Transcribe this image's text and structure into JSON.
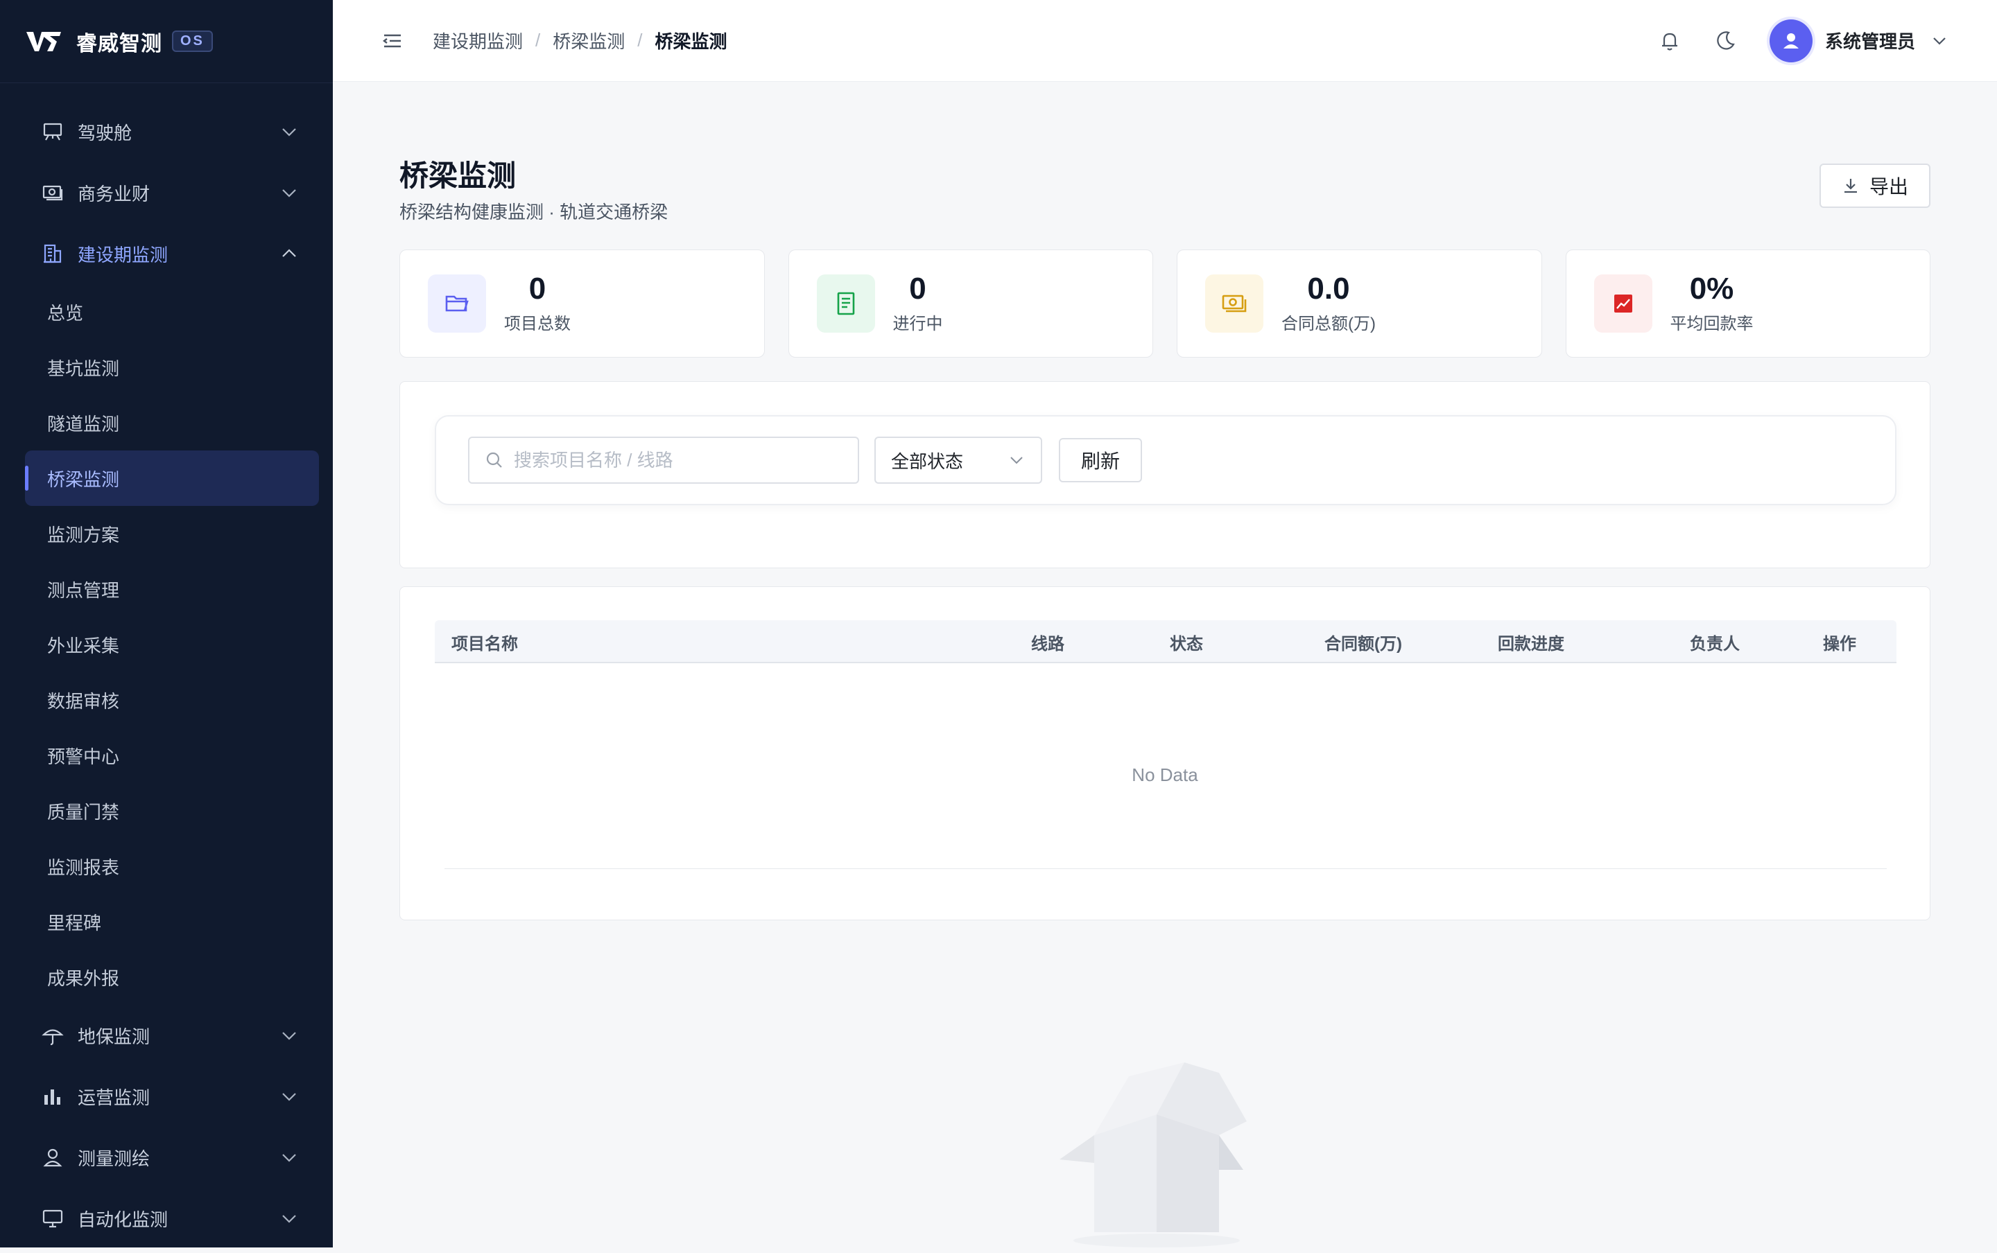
{
  "app": {
    "name": "睿威智测",
    "badge": "OS"
  },
  "sidebar": {
    "groups_top": [
      {
        "label": "驾驶舱",
        "icon": "presentation-board-icon"
      },
      {
        "label": "商务业财",
        "icon": "cash-icon"
      }
    ],
    "open_group": {
      "label": "建设期监测",
      "icon": "building-icon"
    },
    "subitems": [
      "总览",
      "基坑监测",
      "隧道监测",
      "桥梁监测",
      "监测方案",
      "测点管理",
      "外业采集",
      "数据审核",
      "预警中心",
      "质量门禁",
      "监测报表",
      "里程碑",
      "成果外报"
    ],
    "active_subitem": "桥梁监测",
    "groups_bottom": [
      {
        "label": "地保监测",
        "icon": "umbrella-icon"
      },
      {
        "label": "运营监测",
        "icon": "bar-chart-icon"
      },
      {
        "label": "测量测绘",
        "icon": "user-location-icon"
      },
      {
        "label": "自动化监测",
        "icon": "monitor-icon"
      }
    ]
  },
  "header": {
    "breadcrumb": [
      "建设期监测",
      "桥梁监测",
      "桥梁监测"
    ],
    "user_name": "系统管理员"
  },
  "page": {
    "title": "桥梁监测",
    "subtitle": "桥梁结构健康监测 · 轨道交通桥梁",
    "export_label": "导出"
  },
  "stats": [
    {
      "value": "0",
      "label": "项目总数",
      "icon": "folder-icon",
      "color": "#5b5ff0",
      "bg": "#eef0ff"
    },
    {
      "value": "0",
      "label": "进行中",
      "icon": "document-icon",
      "color": "#16a34a",
      "bg": "#e8f8ee"
    },
    {
      "value": "0.0",
      "label": "合同总额(万)",
      "icon": "money-icon",
      "color": "#d69e12",
      "bg": "#fdf6e3"
    },
    {
      "value": "0%",
      "label": "平均回款率",
      "icon": "trend-chart-icon",
      "color": "#dc2626",
      "bg": "#fdeeee"
    }
  ],
  "filters": {
    "search_placeholder": "搜索项目名称 / 线路",
    "status_select": "全部状态",
    "refresh_label": "刷新"
  },
  "table": {
    "columns": [
      "项目名称",
      "线路",
      "状态",
      "合同额(万)",
      "回款进度",
      "负责人",
      "操作"
    ],
    "empty_text": "No Data"
  },
  "colors": {
    "sidebar_bg": "#101a2e",
    "accent": "#5b5ff0",
    "active_bg": "#1e2a55"
  }
}
